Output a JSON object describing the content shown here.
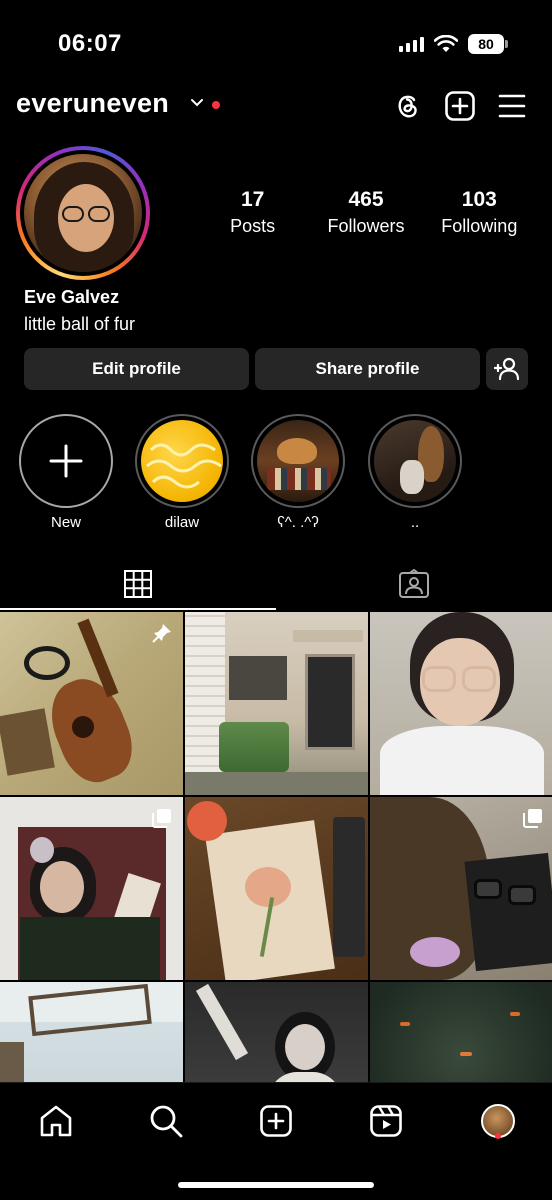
{
  "status_bar": {
    "time": "06:07",
    "battery": "80"
  },
  "header": {
    "username": "everuneven",
    "icons": [
      "threads-icon",
      "create-post-icon",
      "menu-icon"
    ]
  },
  "profile": {
    "stats": [
      {
        "value": "17",
        "label": "Posts"
      },
      {
        "value": "465",
        "label": "Followers"
      },
      {
        "value": "103",
        "label": "Following"
      }
    ],
    "display_name": "Eve Galvez",
    "bio": "little ball of fur",
    "buttons": {
      "edit": "Edit profile",
      "share": "Share profile"
    }
  },
  "highlights": [
    {
      "label": "New"
    },
    {
      "label": "dilaw"
    },
    {
      "label": "ʕ^. .^ʔ"
    },
    {
      "label": ".."
    }
  ],
  "grid_badges": [
    "pin-icon",
    "",
    "",
    "",
    "",
    "",
    "",
    "carousel-icon",
    "carousel-icon"
  ],
  "accent_color": "#ff3040",
  "nav": [
    "home-icon",
    "search-icon",
    "create-icon",
    "reels-icon",
    "profile-avatar"
  ]
}
